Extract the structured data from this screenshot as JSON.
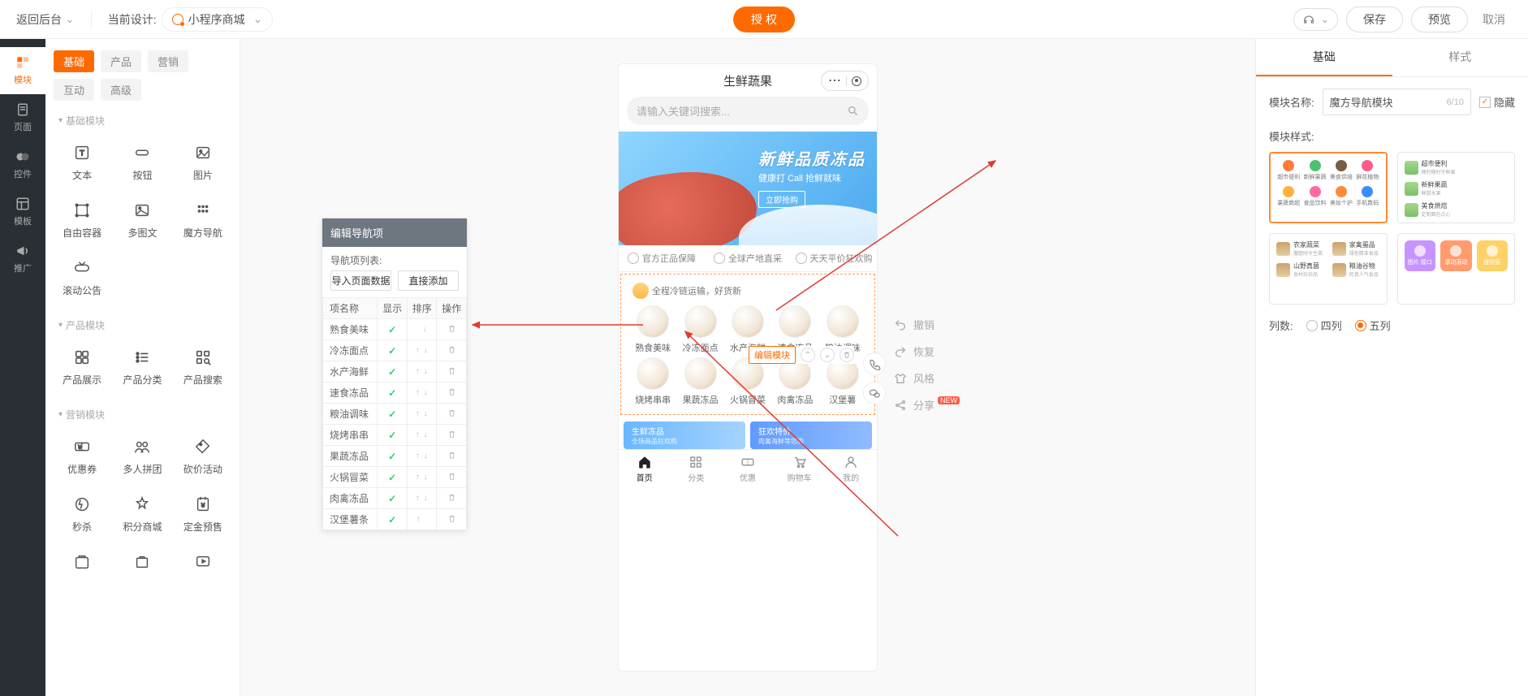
{
  "header": {
    "back": "返回后台",
    "current_design_label": "当前设计:",
    "current_design_value": "小程序商城",
    "auth": "授 权",
    "save": "保存",
    "preview": "预览",
    "cancel": "取消"
  },
  "rail": {
    "modules": "模块",
    "pages": "页面",
    "controls": "控件",
    "templates": "模板",
    "promotion": "推广"
  },
  "comp_tabs": {
    "basic": "基础",
    "product": "产品",
    "marketing": "营销",
    "interact": "互动",
    "advanced": "高级"
  },
  "comp_sections": {
    "basic_hdr": "基础模块",
    "product_hdr": "产品模块",
    "marketing_hdr": "营销模块",
    "basic": [
      "文本",
      "按钮",
      "图片",
      "自由容器",
      "多图文",
      "魔方导航",
      "滚动公告"
    ],
    "product": [
      "产品展示",
      "产品分类",
      "产品搜索"
    ],
    "marketing": [
      "优惠券",
      "多人拼团",
      "砍价活动",
      "秒杀",
      "积分商城",
      "定金预售"
    ]
  },
  "popover": {
    "title": "编辑导航项",
    "list_label": "导航项列表:",
    "import_btn": "导入页面数据",
    "add_btn": "直接添加",
    "cols": {
      "name": "项名称",
      "show": "显示",
      "sort": "排序",
      "ops": "操作"
    },
    "rows": [
      {
        "name": "熟食美味",
        "show": true,
        "sort": "down"
      },
      {
        "name": "冷冻面点",
        "show": true,
        "sort": "both"
      },
      {
        "name": "水产海鲜",
        "show": true,
        "sort": "both"
      },
      {
        "name": "速食冻品",
        "show": true,
        "sort": "both"
      },
      {
        "name": "粮油调味",
        "show": true,
        "sort": "both"
      },
      {
        "name": "烧烤串串",
        "show": true,
        "sort": "both"
      },
      {
        "name": "果蔬冻品",
        "show": true,
        "sort": "both"
      },
      {
        "name": "火锅冒菜",
        "show": true,
        "sort": "both"
      },
      {
        "name": "肉禽冻品",
        "show": true,
        "sort": "both"
      },
      {
        "name": "汉堡薯条",
        "show": true,
        "sort": "up"
      }
    ]
  },
  "phone": {
    "title": "生鲜蔬果",
    "search_placeholder": "请输入关键词搜索...",
    "banner": {
      "line1": "新鲜品质冻品",
      "line2": "健康打 Call 抢鲜就味",
      "btn": "立即抢购"
    },
    "trust": [
      "官方正品保障",
      "全球产地直采",
      "天天平价狂欢购"
    ],
    "nav_strip": "全程冷链运输，好货新",
    "nav_items": [
      "熟食美味",
      "冷冻面点",
      "水产海鲜",
      "速食冻品",
      "粮油调味",
      "烧烤串串",
      "果蔬冻品",
      "火锅冒菜",
      "肉禽冻品",
      "汉堡薯"
    ],
    "promo1": {
      "a": "生鲜冻品",
      "b": "全场商品狂欢购"
    },
    "promo2": {
      "a": "狂欢特价",
      "b": "肉禽海鲜等您购"
    },
    "tabbar": [
      "首页",
      "分类",
      "优惠",
      "购物车",
      "我的"
    ]
  },
  "edit_chip": "编辑模块",
  "side_actions": {
    "undo": "撤销",
    "redo": "恢复",
    "style": "风格",
    "share": "分享",
    "new": "NEW"
  },
  "prop": {
    "tab_basic": "基础",
    "tab_style": "样式",
    "name_label": "模块名称:",
    "name_value": "魔方导航模块",
    "name_count": "6/10",
    "hide": "隐藏",
    "style_label": "模块样式:",
    "cols_label": "列数:",
    "col4": "四列",
    "col5": "五列",
    "style1_items": [
      {
        "label": "超市便利",
        "color": "#ff7a3c"
      },
      {
        "label": "新鲜果蔬",
        "color": "#4fc06e"
      },
      {
        "label": "美食烘焙",
        "color": "#7a5c44"
      },
      {
        "label": "鲜花植物",
        "color": "#ff5c8a"
      },
      {
        "label": "果蔬商超",
        "color": "#ffb03c"
      },
      {
        "label": "食品饮料",
        "color": "#ff6aa5"
      },
      {
        "label": "美妆个护",
        "color": "#ff8a3c"
      },
      {
        "label": "手机数码",
        "color": "#3c8cff"
      }
    ],
    "style2_items": [
      {
        "a": "超市便利",
        "b": "随时随时令鲜果"
      },
      {
        "a": "新鲜果蔬",
        "b": "鲜甜水果"
      },
      {
        "a": "美食烘焙",
        "b": "定制面包点心"
      }
    ],
    "style3_items": [
      {
        "a": "农家蔬菜",
        "b": "撒肥时令生菜"
      },
      {
        "a": "家禽蛋品",
        "b": "绿色精准食品"
      },
      {
        "a": "山野真菌",
        "b": "食材珍珍品"
      },
      {
        "a": "粮油谷物",
        "b": "民真人气食品"
      }
    ],
    "style4_items": [
      {
        "label": "图片 接口",
        "color": "#c794ff"
      },
      {
        "label": "滚动滚动",
        "color": "#ff9b6d"
      },
      {
        "label": "按钮窗",
        "color": "#ffd166"
      }
    ]
  }
}
